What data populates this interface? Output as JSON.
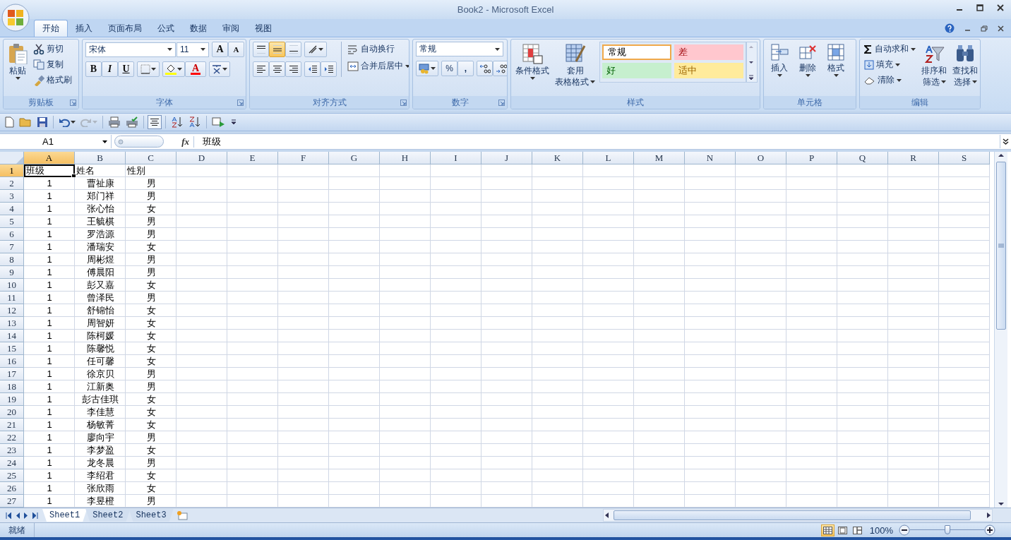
{
  "window": {
    "title": "Book2 - Microsoft Excel"
  },
  "ribbon_tabs": [
    {
      "label": "开始",
      "selected": true
    },
    {
      "label": "插入",
      "selected": false
    },
    {
      "label": "页面布局",
      "selected": false
    },
    {
      "label": "公式",
      "selected": false
    },
    {
      "label": "数据",
      "selected": false
    },
    {
      "label": "审阅",
      "selected": false
    },
    {
      "label": "视图",
      "selected": false
    }
  ],
  "clipboard": {
    "label": "剪贴板",
    "launcher": true,
    "paste": "粘贴",
    "commands": [
      "剪切",
      "复制",
      "格式刷"
    ]
  },
  "font": {
    "label": "字体",
    "launcher": true,
    "font_name": "宋体",
    "font_size": "11",
    "grow": "A",
    "shrink": "A",
    "style_buttons": [
      "B",
      "I",
      "U"
    ],
    "color_letter": "A"
  },
  "alignment": {
    "label": "对齐方式",
    "launcher": true,
    "vertical_align": [
      {
        "selected": false
      },
      {
        "selected": true
      },
      {
        "selected": false
      }
    ],
    "wrap_text": "自动换行",
    "merge": "合并后居中"
  },
  "number": {
    "label": "数字",
    "launcher": true,
    "format": "常规",
    "percent": "%",
    "comma": ","
  },
  "styles": {
    "label": "样式",
    "launcher": false,
    "conditional_format": "条件格式",
    "table_format": [
      "套用",
      "表格格式"
    ],
    "cell_styles": [
      {
        "label": "常规",
        "kind": "normal",
        "selected": true
      },
      {
        "label": "差",
        "kind": "bad",
        "selected": false
      },
      {
        "label": "好",
        "kind": "good",
        "selected": false
      },
      {
        "label": "适中",
        "kind": "neutral",
        "selected": false
      }
    ]
  },
  "cells": {
    "label": "单元格",
    "launcher": false,
    "commands": [
      "插入",
      "删除",
      "格式"
    ]
  },
  "editing": {
    "label": "编辑",
    "launcher": false,
    "commands": [
      "自动求和",
      "填充",
      "清除"
    ],
    "sort_filter": [
      "排序和",
      "筛选"
    ],
    "find_select": [
      "查找和",
      "选择"
    ]
  },
  "quick_access": {
    "center_pressed": true,
    "redo_disabled": true
  },
  "formula_bar": {
    "name_box": "A1",
    "function_label": "fx",
    "formula": "班级"
  },
  "columns": [
    {
      "label": "A",
      "selected": true
    },
    {
      "label": "B",
      "selected": false
    },
    {
      "label": "C",
      "selected": false
    },
    {
      "label": "D",
      "selected": false
    },
    {
      "label": "E",
      "selected": false
    },
    {
      "label": "F",
      "selected": false
    },
    {
      "label": "G",
      "selected": false
    },
    {
      "label": "H",
      "selected": false
    },
    {
      "label": "I",
      "selected": false
    },
    {
      "label": "J",
      "selected": false
    },
    {
      "label": "K",
      "selected": false
    },
    {
      "label": "L",
      "selected": false
    },
    {
      "label": "M",
      "selected": false
    },
    {
      "label": "N",
      "selected": false
    },
    {
      "label": "O",
      "selected": false
    },
    {
      "label": "P",
      "selected": false
    },
    {
      "label": "Q",
      "selected": false
    },
    {
      "label": "R",
      "selected": false
    },
    {
      "label": "S",
      "selected": false
    }
  ],
  "rows": [
    {
      "number": "1",
      "kind": "header",
      "selected": true,
      "cells": [
        "班级",
        "姓名",
        "性别"
      ]
    },
    {
      "number": "2",
      "kind": "data",
      "selected": false,
      "cells": [
        "1",
        "曹祉康",
        "男"
      ]
    },
    {
      "number": "3",
      "kind": "data",
      "selected": false,
      "cells": [
        "1",
        "郑门祥",
        "男"
      ]
    },
    {
      "number": "4",
      "kind": "data",
      "selected": false,
      "cells": [
        "1",
        "张心怡",
        "女"
      ]
    },
    {
      "number": "5",
      "kind": "data",
      "selected": false,
      "cells": [
        "1",
        "王毓棋",
        "男"
      ]
    },
    {
      "number": "6",
      "kind": "data",
      "selected": false,
      "cells": [
        "1",
        "罗浩源",
        "男"
      ]
    },
    {
      "number": "7",
      "kind": "data",
      "selected": false,
      "cells": [
        "1",
        "潘瑞安",
        "女"
      ]
    },
    {
      "number": "8",
      "kind": "data",
      "selected": false,
      "cells": [
        "1",
        "周彬煜",
        "男"
      ]
    },
    {
      "number": "9",
      "kind": "data",
      "selected": false,
      "cells": [
        "1",
        "傅晨阳",
        "男"
      ]
    },
    {
      "number": "10",
      "kind": "data",
      "selected": false,
      "cells": [
        "1",
        "彭又嘉",
        "女"
      ]
    },
    {
      "number": "11",
      "kind": "data",
      "selected": false,
      "cells": [
        "1",
        "曾泽民",
        "男"
      ]
    },
    {
      "number": "12",
      "kind": "data",
      "selected": false,
      "cells": [
        "1",
        "舒锦怡",
        "女"
      ]
    },
    {
      "number": "13",
      "kind": "data",
      "selected": false,
      "cells": [
        "1",
        "周智妍",
        "女"
      ]
    },
    {
      "number": "14",
      "kind": "data",
      "selected": false,
      "cells": [
        "1",
        "陈柯媛",
        "女"
      ]
    },
    {
      "number": "15",
      "kind": "data",
      "selected": false,
      "cells": [
        "1",
        "陈馨悦",
        "女"
      ]
    },
    {
      "number": "16",
      "kind": "data",
      "selected": false,
      "cells": [
        "1",
        "任可馨",
        "女"
      ]
    },
    {
      "number": "17",
      "kind": "data",
      "selected": false,
      "cells": [
        "1",
        "徐京贝",
        "男"
      ]
    },
    {
      "number": "18",
      "kind": "data",
      "selected": false,
      "cells": [
        "1",
        "江新奥",
        "男"
      ]
    },
    {
      "number": "19",
      "kind": "data",
      "selected": false,
      "cells": [
        "1",
        "彭古佳琪",
        "女"
      ]
    },
    {
      "number": "20",
      "kind": "data",
      "selected": false,
      "cells": [
        "1",
        "李佳慧",
        "女"
      ]
    },
    {
      "number": "21",
      "kind": "data",
      "selected": false,
      "cells": [
        "1",
        "杨敏菁",
        "女"
      ]
    },
    {
      "number": "22",
      "kind": "data",
      "selected": false,
      "cells": [
        "1",
        "廖向宇",
        "男"
      ]
    },
    {
      "number": "23",
      "kind": "data",
      "selected": false,
      "cells": [
        "1",
        "李梦盈",
        "女"
      ]
    },
    {
      "number": "24",
      "kind": "data",
      "selected": false,
      "cells": [
        "1",
        "龙冬晨",
        "男"
      ]
    },
    {
      "number": "25",
      "kind": "data",
      "selected": false,
      "cells": [
        "1",
        "李绍君",
        "女"
      ]
    },
    {
      "number": "26",
      "kind": "data",
      "selected": false,
      "cells": [
        "1",
        "张欣雨",
        "女"
      ]
    },
    {
      "number": "27",
      "kind": "data",
      "selected": false,
      "cells": [
        "1",
        "李昱橙",
        "男"
      ]
    }
  ],
  "sheet_tabs": [
    {
      "label": "Sheet1",
      "selected": true
    },
    {
      "label": "Sheet2",
      "selected": false
    },
    {
      "label": "Sheet3",
      "selected": false
    }
  ],
  "status_bar": {
    "status": "就绪",
    "views": [
      {
        "selected": true
      },
      {
        "selected": false
      },
      {
        "selected": false
      }
    ],
    "zoom": "100%",
    "zoom_slider": {
      "level": 0.5
    }
  }
}
